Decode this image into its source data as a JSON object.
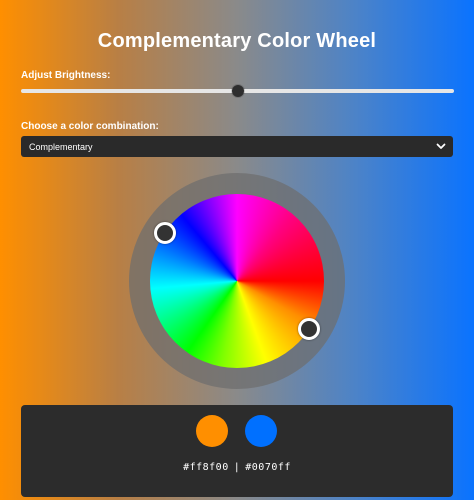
{
  "header": {
    "title": "Complementary Color Wheel"
  },
  "brightness": {
    "label": "Adjust Brightness:",
    "value_fraction": 0.5
  },
  "combination": {
    "label": "Choose a color combination:",
    "selected": "Complementary",
    "icon": "chevron-down-icon"
  },
  "wheel": {
    "handles": [
      {
        "name": "primary",
        "color": "#ff8f00"
      },
      {
        "name": "complement",
        "color": "#0070ff"
      }
    ]
  },
  "swatches": {
    "primary_color": "#ff8f00",
    "secondary_color": "#0070ff",
    "primary_hex": "#ff8f00",
    "separator": "|",
    "secondary_hex": "#0070ff"
  }
}
